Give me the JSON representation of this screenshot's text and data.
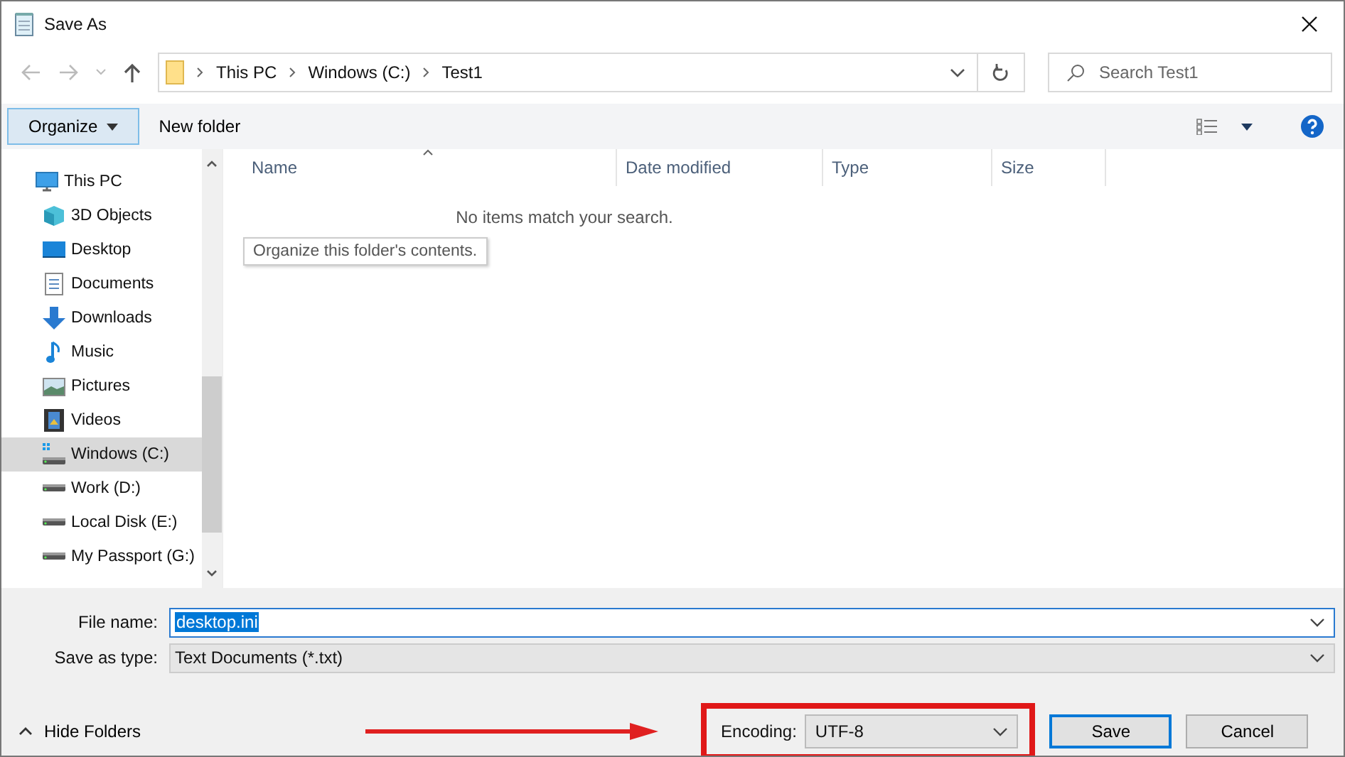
{
  "window": {
    "title": "Save As"
  },
  "address_bar": {
    "path": [
      "This PC",
      "Windows (C:)",
      "Test1"
    ]
  },
  "search": {
    "placeholder": "Search Test1"
  },
  "toolbar": {
    "organize": "Organize",
    "new_folder": "New folder"
  },
  "tooltip": "Organize this folder's contents.",
  "sidebar": {
    "items": [
      {
        "label": "This PC",
        "kind": "pc",
        "selected": false,
        "children": [
          {
            "label": "3D Objects",
            "kind": "cube",
            "selected": false
          },
          {
            "label": "Desktop",
            "kind": "desktop",
            "selected": false
          },
          {
            "label": "Documents",
            "kind": "documents",
            "selected": false
          },
          {
            "label": "Downloads",
            "kind": "downloads",
            "selected": false
          },
          {
            "label": "Music",
            "kind": "music",
            "selected": false
          },
          {
            "label": "Pictures",
            "kind": "pictures",
            "selected": false
          },
          {
            "label": "Videos",
            "kind": "videos",
            "selected": false
          },
          {
            "label": "Windows (C:)",
            "kind": "system-drive",
            "selected": true
          },
          {
            "label": "Work (D:)",
            "kind": "drive",
            "selected": false
          },
          {
            "label": "Local Disk (E:)",
            "kind": "drive",
            "selected": false
          },
          {
            "label": "My Passport (G:)",
            "kind": "drive",
            "selected": false
          }
        ]
      }
    ]
  },
  "table": {
    "columns": [
      "Name",
      "Date modified",
      "Type",
      "Size"
    ],
    "empty_message": "No items match your search."
  },
  "form": {
    "file_name_label": "File name:",
    "file_name": "desktop.ini",
    "type_label": "Save as type:",
    "type": "Text Documents (*.txt)"
  },
  "footer": {
    "hide_folders": "Hide Folders",
    "encoding_label": "Encoding:",
    "encoding": "UTF-8",
    "buttons": [
      "Save",
      "Cancel"
    ]
  }
}
